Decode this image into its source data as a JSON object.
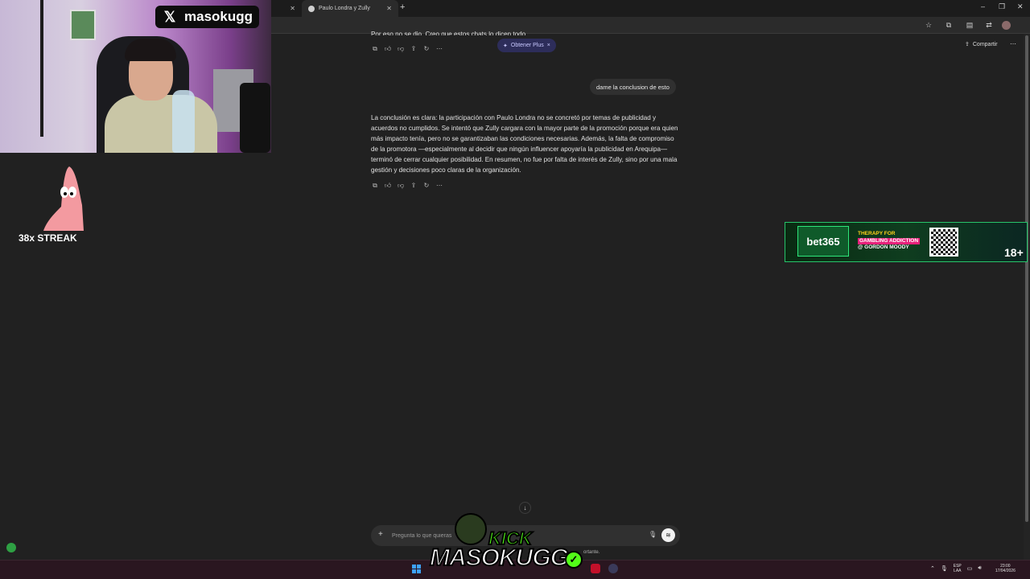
{
  "browser": {
    "tabs": [
      {
        "label": "",
        "active": false
      },
      {
        "label": "Paulo Londra y Zully",
        "active": true
      }
    ],
    "new_tab_glyph": "+",
    "window_controls": [
      "–",
      "❐",
      "✕"
    ]
  },
  "chat": {
    "prev_text_fragment": "Por eso no se dio. Creo que estos chats lo dicen todo.",
    "plus_pill": {
      "label": "Obtener Plus",
      "icon": "sparkle-icon"
    },
    "share_label": "Compartir",
    "user_message": "dame la conclusion de esto",
    "assistant_message": "La conclusión es clara: la participación con Paulo Londra no se concretó por temas de publicidad y acuerdos no cumplidos. Se intentó que Zully cargara con la mayor parte de la promoción porque era quien más impacto tenía, pero no se garantizaban las condiciones necesarias. Además, la falta de compromiso de la promotora —especialmente al decidir que ningún influencer apoyaría la publicidad en Arequipa— terminó de cerrar cualquier posibilidad. En resumen, no fue por falta de interés de Zully, sino por una mala gestión y decisiones poco claras de la organización.",
    "action_icons": [
      "copy-icon",
      "thumbs-up-icon",
      "thumbs-down-icon",
      "share-icon",
      "regenerate-icon",
      "more-icon"
    ],
    "composer": {
      "placeholder": "Pregunta lo que quieras",
      "disclaimer_fragment": "ortante."
    }
  },
  "overlays": {
    "x_handle": "masokugg",
    "streak": "38x STREAK",
    "ad": {
      "brand": "bet365",
      "line1": "THERAPY FOR",
      "line2": "GAMBLING ADDICTION",
      "line3": "@ GORDON MOODY",
      "age": "18+"
    },
    "kick": {
      "word": "KICK",
      "name": "MASOKUGG",
      "check": "✓"
    }
  },
  "taskbar": {
    "language_top": "ESP",
    "language_bottom": "LAA",
    "time": "23:00",
    "date": "17/04/2026"
  }
}
